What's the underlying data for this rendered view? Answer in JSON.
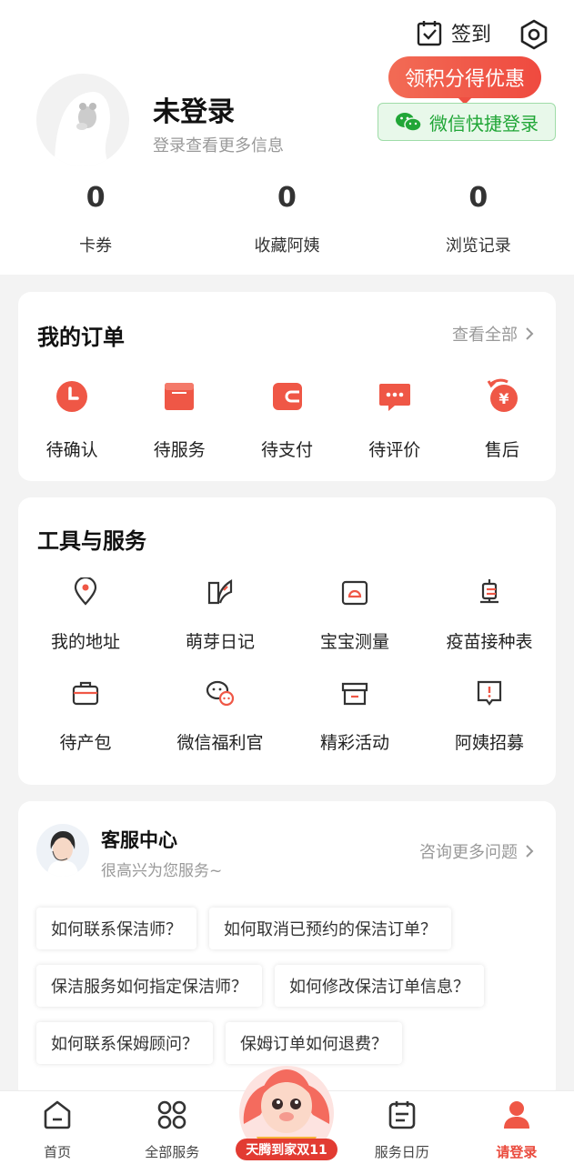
{
  "header": {
    "checkin_label": "签到",
    "promo_label": "领积分得优惠",
    "wechat_login_label": "微信快捷登录",
    "login_title": "未登录",
    "login_subtitle": "登录查看更多信息"
  },
  "stats": [
    {
      "value": "0",
      "label": "卡券"
    },
    {
      "value": "0",
      "label": "收藏阿姨"
    },
    {
      "value": "0",
      "label": "浏览记录"
    }
  ],
  "orders": {
    "title": "我的订单",
    "view_all": "查看全部",
    "items": [
      {
        "label": "待确认",
        "icon": "clock-icon"
      },
      {
        "label": "待服务",
        "icon": "calendar-icon"
      },
      {
        "label": "待支付",
        "icon": "wallet-icon"
      },
      {
        "label": "待评价",
        "icon": "comment-icon"
      },
      {
        "label": "售后",
        "icon": "refund-icon"
      }
    ]
  },
  "tools": {
    "title": "工具与服务",
    "items": [
      {
        "label": "我的地址",
        "icon": "location-icon"
      },
      {
        "label": "萌芽日记",
        "icon": "diary-icon"
      },
      {
        "label": "宝宝测量",
        "icon": "scale-icon"
      },
      {
        "label": "疫苗接种表",
        "icon": "vaccine-icon"
      },
      {
        "label": "待产包",
        "icon": "bag-icon"
      },
      {
        "label": "微信福利官",
        "icon": "wechat-chat-icon"
      },
      {
        "label": "精彩活动",
        "icon": "store-icon"
      },
      {
        "label": "阿姨招募",
        "icon": "alert-icon"
      }
    ]
  },
  "service": {
    "title": "客服中心",
    "subtitle": "很高兴为您服务~",
    "more": "咨询更多问题",
    "questions": [
      [
        "如何联系保洁师？",
        "如何取消已预约的保洁订单？"
      ],
      [
        "保洁服务如何指定保洁师？",
        "如何修改保洁订单信息？"
      ],
      [
        "如何联系保姆顾问？",
        "保姆订单如何退费？"
      ]
    ]
  },
  "tabbar": {
    "items": [
      {
        "label": "首页",
        "icon": "home-icon"
      },
      {
        "label": "全部服务",
        "icon": "grid-icon"
      },
      {
        "label": "服务日历",
        "icon": "calendar-list-icon"
      },
      {
        "label": "请登录",
        "icon": "user-icon"
      }
    ],
    "promo_badge": "天腾到家双11"
  },
  "colors": {
    "accent": "#ea4b3e",
    "wechat": "#21a637"
  }
}
